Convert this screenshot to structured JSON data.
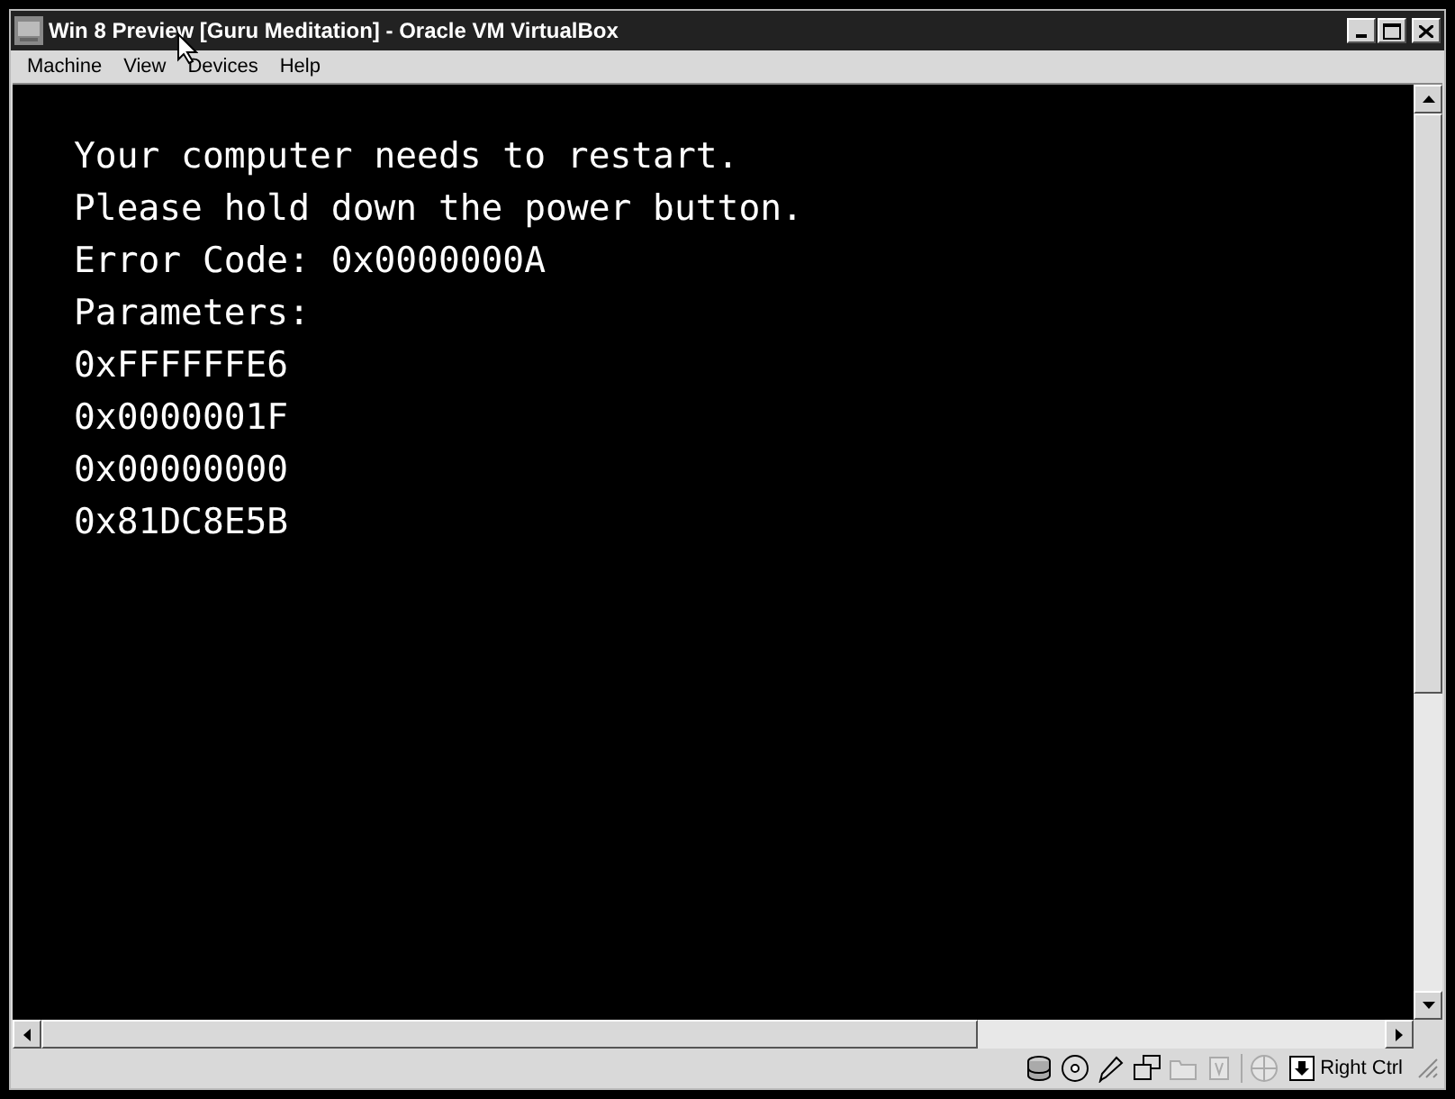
{
  "window": {
    "title": "Win 8 Preview [Guru Meditation] - Oracle VM VirtualBox"
  },
  "menu": [
    "Machine",
    "View",
    "Devices",
    "Help"
  ],
  "console": {
    "lines": [
      "Your computer needs to restart.",
      "Please hold down the power button.",
      "Error Code: 0x0000000A",
      "Parameters:",
      "0xFFFFFFE6",
      "0x0000001F",
      "0x00000000",
      "0x81DC8E5B"
    ]
  },
  "status_bar": {
    "indicators": [
      {
        "kind": "disks",
        "disabled": false
      },
      {
        "kind": "optical",
        "disabled": false
      },
      {
        "kind": "usb",
        "disabled": false
      },
      {
        "kind": "network",
        "disabled": false
      },
      {
        "kind": "folder",
        "disabled": true
      },
      {
        "kind": "chip",
        "disabled": true
      },
      {
        "kind": "mouse",
        "disabled": true
      }
    ],
    "host_key": "Right Ctrl"
  }
}
